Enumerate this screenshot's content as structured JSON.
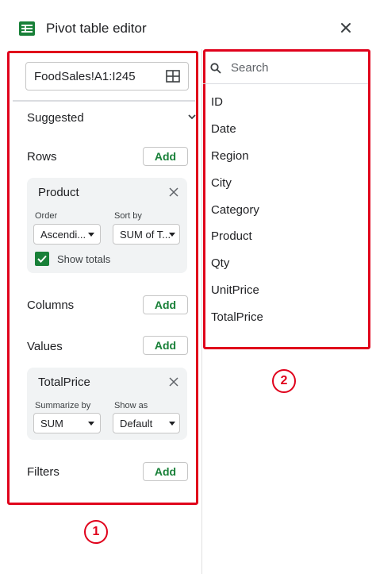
{
  "header": {
    "title": "Pivot table editor",
    "close_icon": "close-icon",
    "app_icon": "sheets-icon"
  },
  "range": {
    "value": "FoodSales!A1:I245",
    "icon": "grid-select-icon"
  },
  "suggested": {
    "label": "Suggested"
  },
  "rows": {
    "label": "Rows",
    "add_label": "Add",
    "card": {
      "title": "Product",
      "order_label": "Order",
      "order_value": "Ascendi...",
      "sort_label": "Sort by",
      "sort_value": "SUM of T...",
      "show_totals_label": "Show totals",
      "show_totals_checked": true
    }
  },
  "columns": {
    "label": "Columns",
    "add_label": "Add"
  },
  "values": {
    "label": "Values",
    "add_label": "Add",
    "card": {
      "title": "TotalPrice",
      "summarize_label": "Summarize by",
      "summarize_value": "SUM",
      "showas_label": "Show as",
      "showas_value": "Default"
    }
  },
  "filters": {
    "label": "Filters",
    "add_label": "Add"
  },
  "field_list": {
    "search_placeholder": "Search",
    "fields": [
      "ID",
      "Date",
      "Region",
      "City",
      "Category",
      "Product",
      "Qty",
      "UnitPrice",
      "TotalPrice"
    ]
  },
  "annotations": {
    "marker_1": "1",
    "marker_2": "2"
  },
  "colors": {
    "accent": "#188038",
    "annotation": "#e0001b"
  }
}
